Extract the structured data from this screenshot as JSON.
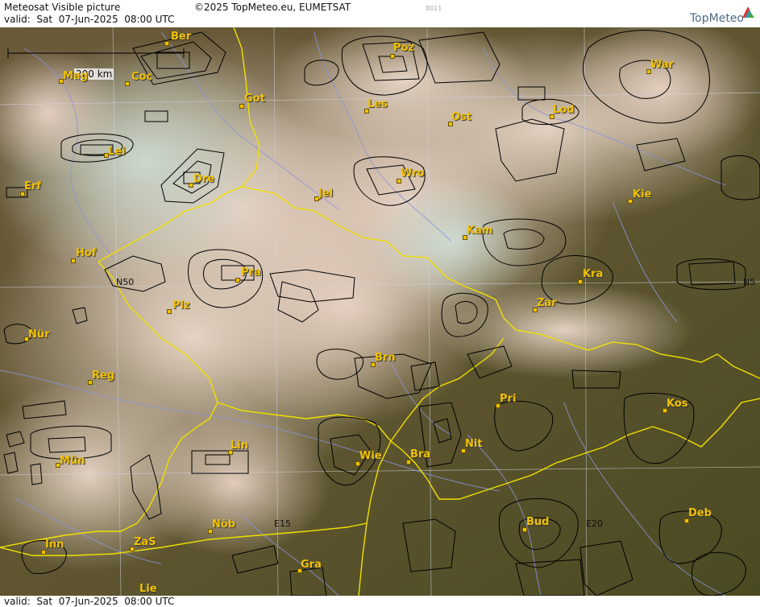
{
  "header": {
    "title": "Meteosat Visible picture",
    "valid": "valid:  Sat  07-Jun-2025  08:00 UTC",
    "copyright": "©2025 TopMeteo.eu, EUMETSAT",
    "code": "8011",
    "logo": "TopMeteo"
  },
  "footer": {
    "valid": "valid:  Sat  07-Jun-2025  08:00 UTC"
  },
  "scale_bar": {
    "label": "200 km"
  },
  "grid_labels": {
    "n50_left": "N50",
    "n50_right": "N5",
    "e15": "E15",
    "e20": "E20"
  },
  "cities": [
    {
      "name": "Ber"
    },
    {
      "name": "Mag"
    },
    {
      "name": "Coc"
    },
    {
      "name": "Got"
    },
    {
      "name": "Poz"
    },
    {
      "name": "War"
    },
    {
      "name": "Les"
    },
    {
      "name": "Ost"
    },
    {
      "name": "Lod"
    },
    {
      "name": "Lei"
    },
    {
      "name": "Dre"
    },
    {
      "name": "Erf"
    },
    {
      "name": "Wro"
    },
    {
      "name": "Jel"
    },
    {
      "name": "Kie"
    },
    {
      "name": "Kam"
    },
    {
      "name": "Hof"
    },
    {
      "name": "Pra"
    },
    {
      "name": "Kra"
    },
    {
      "name": "Plz"
    },
    {
      "name": "Zar"
    },
    {
      "name": "Nür"
    },
    {
      "name": "Brn"
    },
    {
      "name": "Reg"
    },
    {
      "name": "Pri"
    },
    {
      "name": "Kos"
    },
    {
      "name": "Lin"
    },
    {
      "name": "Nit"
    },
    {
      "name": "Wie"
    },
    {
      "name": "Bra"
    },
    {
      "name": "Mün"
    },
    {
      "name": "Nöb"
    },
    {
      "name": "Bud"
    },
    {
      "name": "Deb"
    },
    {
      "name": "ZaS"
    },
    {
      "name": "Inn"
    },
    {
      "name": "Gra"
    },
    {
      "name": "Lie"
    }
  ],
  "colors": {
    "border": "#f0e000",
    "river": "#8a94d8",
    "label": "#f2c200",
    "airspace": "#000000"
  }
}
